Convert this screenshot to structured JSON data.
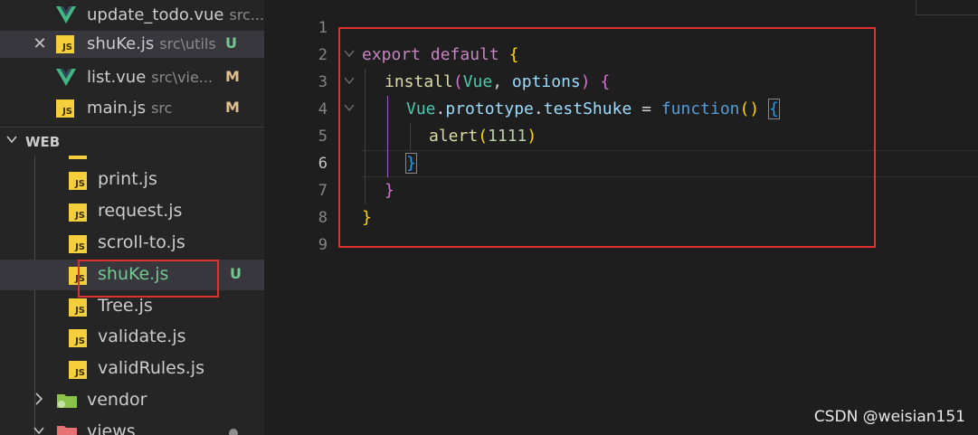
{
  "open_editors": [
    {
      "name": "update_todo.vue",
      "path": "src...",
      "status": "",
      "icon": "vue-icon",
      "active": false,
      "close": false
    },
    {
      "name": "shuKe.js",
      "path": "src\\utils",
      "status": "U",
      "icon": "js-icon",
      "active": true,
      "close": true
    },
    {
      "name": "list.vue",
      "path": "src\\vie...",
      "status": "M",
      "icon": "vue-icon",
      "active": false,
      "close": false
    },
    {
      "name": "main.js",
      "path": "src",
      "status": "M",
      "icon": "js-icon",
      "active": false,
      "close": false
    }
  ],
  "close_glyph": "✕",
  "js_glyph": "JS",
  "explorer": {
    "section_title": "WEB",
    "files": [
      {
        "name": "print.js",
        "status": ""
      },
      {
        "name": "request.js",
        "status": ""
      },
      {
        "name": "scroll-to.js",
        "status": ""
      },
      {
        "name": "shuKe.js",
        "status": "U"
      },
      {
        "name": "Tree.js",
        "status": ""
      },
      {
        "name": "validate.js",
        "status": ""
      },
      {
        "name": "validRules.js",
        "status": ""
      }
    ],
    "folders": [
      {
        "name": "vendor",
        "expanded": false
      },
      {
        "name": "views",
        "expanded": true
      }
    ]
  },
  "editor": {
    "line_numbers": [
      "1",
      "2",
      "3",
      "4",
      "5",
      "6",
      "7",
      "8",
      "9"
    ],
    "current_line": 6,
    "code": {
      "l2": {
        "kw1": "export",
        "kw2": "default",
        "brace": "{"
      },
      "l3": {
        "fn": "install",
        "open": "(",
        "p1": "Vue",
        "comma": ", ",
        "p2": "options",
        "close": ")",
        "brace": "{"
      },
      "l4": {
        "obj": "Vue",
        "dot1": ".",
        "prop1": "prototype",
        "dot2": ".",
        "prop2": "testShuke",
        "eq": " = ",
        "kw": "function",
        "parens": "()",
        "brace": "{"
      },
      "l5": {
        "fn": "alert",
        "open": "(",
        "num": "1111",
        "close": ")"
      },
      "l6": {
        "brace": "}"
      },
      "l7": {
        "brace": "}"
      },
      "l8": {
        "brace": "}"
      }
    }
  },
  "watermark": "CSDN @weisian151",
  "colors": {
    "annotation_red": "#e03131",
    "untracked_green": "#73c991",
    "modified_yellow": "#e2c08d",
    "js_yellow": "#f5cf3b",
    "vue_green": "#41b883"
  }
}
